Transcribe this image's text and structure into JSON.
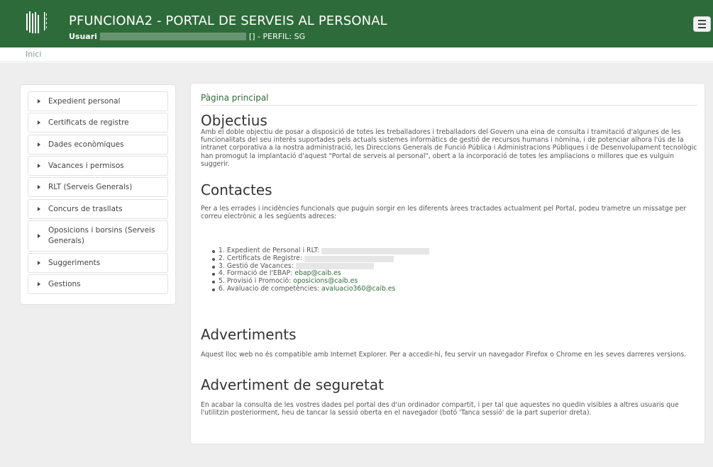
{
  "header": {
    "title": "PFUNCIONA2 - PORTAL DE SERVEIS AL PERSONAL",
    "user_label": "Usuari",
    "profile_text": "[] - PERFIL: SG",
    "background": "#2e6b3a",
    "logo_icon": "caib-logo-icon",
    "menu_icon": "hamburger-icon"
  },
  "breadcrumb": {
    "home": "Inici"
  },
  "sidebar": {
    "items": [
      {
        "label": "Expedient personal"
      },
      {
        "label": "Certificats de registre"
      },
      {
        "label": "Dades econòmiques"
      },
      {
        "label": "Vacances i permisos"
      },
      {
        "label": "RLT (Serveis Generals)"
      },
      {
        "label": "Concurs de trasllats"
      },
      {
        "label": "Oposicions i borsins (Serveis Generals)"
      },
      {
        "label": "Suggeriments"
      },
      {
        "label": "Gestions"
      }
    ]
  },
  "main": {
    "panel_title": "Pàgina principal",
    "objectius": {
      "heading": "Objectius",
      "text": "Amb el doble objectiu de posar a disposició de totes les treballadores i treballadors del Govern una eina de consulta i tramitació d'algunes de les funcionalitats del seu interès suportades pels actuals sistemes informàtics de gestió de recursos humans i nòmina, i de potenciar alhora l'ús de la intranet corporativa a la nostra administració, les Direccions Generals de Funció Pública i Administracions Públiques i de Desenvolupament tecnològic han promogut la implantació d'aquest \"Portal de serveis al personal\", obert a la incorporació de totes les ampliacions o millores que es vulguin suggerir."
    },
    "contactes": {
      "heading": "Contactes",
      "text": "Per a les errades i incidències funcionals que puguin sorgir en les diferents àrees tractades actualment pel Portal, podeu trametre un missatge per correu electrònic a les següents adreces:",
      "items": [
        {
          "label": "1. Expedient de Personal i RLT:",
          "email": ""
        },
        {
          "label": "2. Certificats de Registre:",
          "email": ""
        },
        {
          "label": "3. Gestió de Vacances:",
          "email": ""
        },
        {
          "label": "4. Formació de l'EBAP:",
          "email": "ebap@caib.es"
        },
        {
          "label": "5. Provisió i Promoció:",
          "email": "oposicions@caib.es"
        },
        {
          "label": "6. Avaluacio de competències:",
          "email": "avaluacio360@caib.es"
        }
      ]
    },
    "advertiments": {
      "heading": "Advertiments",
      "text": "Aquest lloc web no és compatible amb Internet Explorer. Per a accedir-hi, feu servir un navegador Firefox o Chrome en les seves darreres versions."
    },
    "seguretat": {
      "heading": "Advertiment de seguretat",
      "text": "En acabar la consulta de les vostres dades pel portal des d'un ordinador compartit, i per tal que aquestes no quedin visibles a altres usuaris que l'utilitzin posteriorment, heu de tancar la sessió oberta en el navegador (botó 'Tanca sessió' de la part superior dreta)."
    }
  }
}
